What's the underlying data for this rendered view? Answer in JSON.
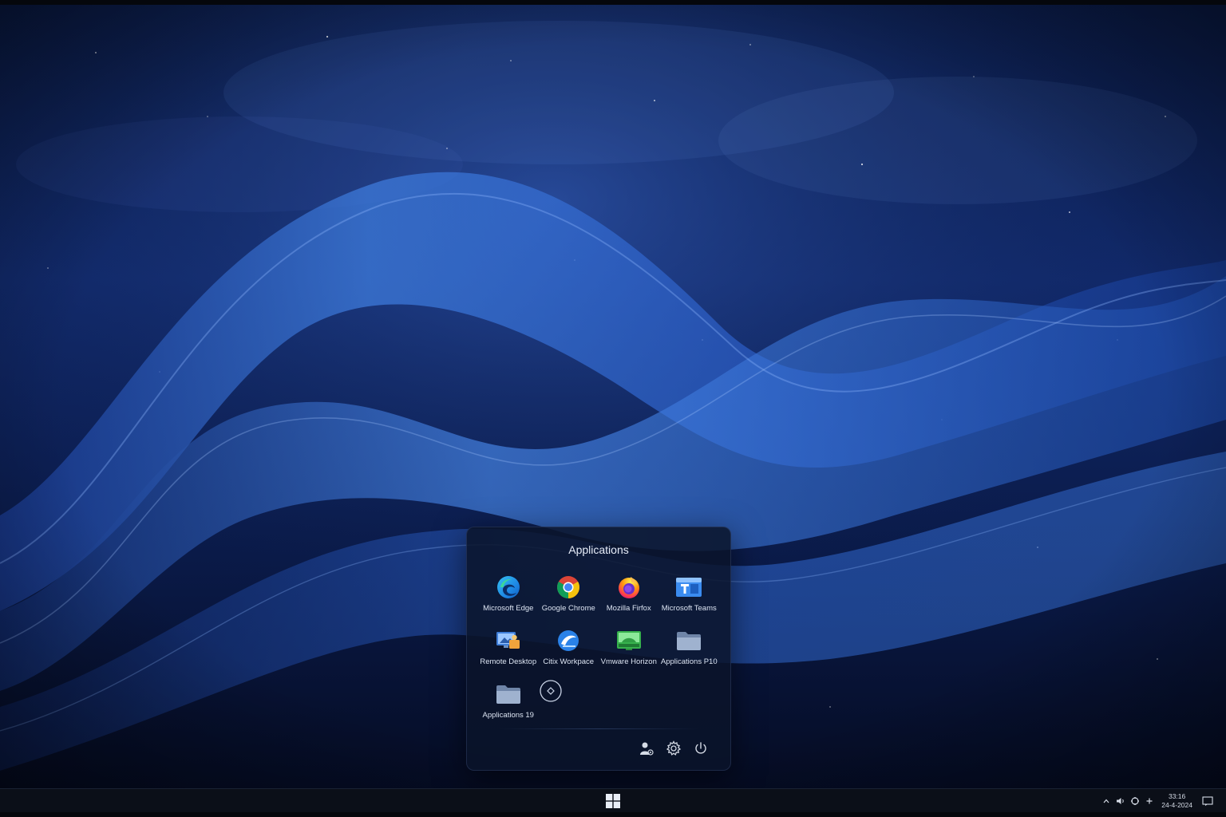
{
  "panel": {
    "title": "Applications",
    "apps": [
      {
        "label": "Microsoft Edge",
        "icon": "edge-icon"
      },
      {
        "label": "Google Chrome",
        "icon": "chrome-icon"
      },
      {
        "label": "Mozilla Firfox",
        "icon": "firefox-icon"
      },
      {
        "label": "Microsoft Teams",
        "icon": "teams-icon"
      },
      {
        "label": "Remote Desktop",
        "icon": "remote-desktop-icon"
      },
      {
        "label": "Citix Workpace",
        "icon": "citrix-icon"
      },
      {
        "label": "Vmware Horizon",
        "icon": "vmware-horizon-icon"
      },
      {
        "label": "Applications P10",
        "icon": "folder-icon"
      },
      {
        "label": "Applications 19",
        "icon": "folder-icon"
      },
      {
        "label": "",
        "icon": "add-app-icon"
      }
    ],
    "actions": [
      "user-settings-icon",
      "gear-icon",
      "power-icon"
    ]
  },
  "taskbar": {
    "start_icon": "windows-logo-icon",
    "tray_icons": [
      "chevron-up-icon",
      "volume-icon",
      "network-icon",
      "plus-icon"
    ],
    "clock": {
      "time": "33:16",
      "date": "24-4-2024"
    },
    "notification_icon": "notification-icon"
  },
  "colors": {
    "wallpaper_base": "#07122e",
    "wave_light": "#4f8fe8",
    "panel_bg": "#0a142a",
    "taskbar_bg": "#0b0f18"
  }
}
